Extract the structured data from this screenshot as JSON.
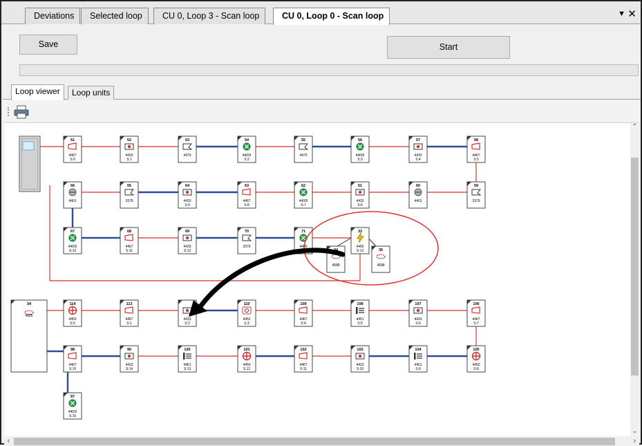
{
  "tabs": [
    {
      "label": "Deviations",
      "active": false
    },
    {
      "label": "Selected loop",
      "active": false
    },
    {
      "label": "CU 0, Loop 3 - Scan loop",
      "active": false
    },
    {
      "label": "CU 0, Loop 0 - Scan loop",
      "active": true
    }
  ],
  "tab_menu_icon": "chevron-down-icon",
  "tab_close_icon": "close-icon",
  "toolbar": {
    "save_label": "Save",
    "start_label": "Start"
  },
  "progress": {
    "value": 0
  },
  "inner_tabs": [
    {
      "label": "Loop viewer",
      "active": true
    },
    {
      "label": "Loop units",
      "active": false
    }
  ],
  "print_icon": "printer-icon",
  "colors": {
    "blue_line": "#2b4a9b",
    "red_line": "#e05050",
    "highlight": "#e03030"
  },
  "loop_units": [
    {
      "addr": "51",
      "type": "4467",
      "sub": "S:0",
      "icon": "sounder-icon"
    },
    {
      "addr": "52",
      "type": "4433",
      "sub": "S:1",
      "icon": "input-module-icon"
    },
    {
      "addr": "53",
      "type": "4479",
      "sub": "",
      "icon": "callpoint-icon"
    },
    {
      "addr": "54",
      "type": "4400I",
      "sub": "S:2",
      "icon": "smoke-detector-icon"
    },
    {
      "addr": "55",
      "type": "4479",
      "sub": "",
      "icon": "callpoint-icon"
    },
    {
      "addr": "56",
      "type": "4400I",
      "sub": "S:3",
      "icon": "smoke-detector-icon"
    },
    {
      "addr": "57",
      "type": "4433",
      "sub": "S:4",
      "icon": "input-module-icon"
    },
    {
      "addr": "58",
      "type": "4467",
      "sub": "S:5",
      "icon": "sounder-icon"
    },
    {
      "addr": "66",
      "type": "4401",
      "sub": "",
      "icon": "heat-detector-icon"
    },
    {
      "addr": "65",
      "type": "3379",
      "sub": "",
      "icon": "callpoint-icon"
    },
    {
      "addr": "64",
      "type": "4433",
      "sub": "S:9",
      "icon": "input-module-icon"
    },
    {
      "addr": "63",
      "type": "4467",
      "sub": "S:8",
      "icon": "sounder-icon"
    },
    {
      "addr": "62",
      "type": "4400I",
      "sub": "S:7",
      "icon": "smoke-detector-icon"
    },
    {
      "addr": "61",
      "type": "4433",
      "sub": "S:6",
      "icon": "input-module-icon"
    },
    {
      "addr": "60",
      "type": "4401",
      "sub": "",
      "icon": "heat-detector-icon"
    },
    {
      "addr": "59",
      "type": "3379",
      "sub": "",
      "icon": "callpoint-icon"
    },
    {
      "addr": "67",
      "type": "4400I",
      "sub": "S:10",
      "icon": "smoke-detector-icon"
    },
    {
      "addr": "68",
      "type": "4467",
      "sub": "S:11",
      "icon": "sounder-icon"
    },
    {
      "addr": "69",
      "type": "4433",
      "sub": "S:12",
      "icon": "input-module-icon"
    },
    {
      "addr": "70",
      "type": "3379",
      "sub": "",
      "icon": "callpoint-icon"
    },
    {
      "addr": "71",
      "type": "4400",
      "sub": "",
      "icon": "smoke-detector-icon"
    },
    {
      "addr": "33",
      "type": "4456",
      "sub": "S:13",
      "icon": "isolator-icon"
    },
    {
      "addr": "34",
      "type": "4588",
      "sub": "",
      "icon": "beacon-icon"
    },
    {
      "addr": "35",
      "type": "4588",
      "sub": "",
      "icon": "beacon-icon"
    },
    {
      "addr": "34",
      "type": "4585",
      "sub": "",
      "icon": "beacon-icon"
    },
    {
      "addr": "114",
      "type": "4450",
      "sub": "S:0",
      "icon": "crosshair-detector-icon"
    },
    {
      "addr": "113",
      "type": "4467",
      "sub": "S:1",
      "icon": "sounder-icon"
    },
    {
      "addr": "",
      "type": "4433",
      "sub": "S:2",
      "icon": "input-module-icon"
    },
    {
      "addr": "110",
      "type": "4452",
      "sub": "S:3",
      "icon": "alarm-device-icon"
    },
    {
      "addr": "109",
      "type": "4467",
      "sub": "S:4",
      "icon": "sounder-icon"
    },
    {
      "addr": "108",
      "type": "4451",
      "sub": "S:5",
      "icon": "io-unit-icon"
    },
    {
      "addr": "107",
      "type": "4433",
      "sub": "S:6",
      "icon": "input-module-icon"
    },
    {
      "addr": "106",
      "type": "4467",
      "sub": "S:7",
      "icon": "sounder-icon"
    },
    {
      "addr": "98",
      "type": "4467",
      "sub": "S:15",
      "icon": "sounder-icon"
    },
    {
      "addr": "99",
      "type": "4433",
      "sub": "S:14",
      "icon": "input-module-icon"
    },
    {
      "addr": "100",
      "type": "4451",
      "sub": "S:13",
      "icon": "io-unit-icon"
    },
    {
      "addr": "101",
      "type": "4450",
      "sub": "S:12",
      "icon": "crosshair-detector-icon"
    },
    {
      "addr": "102",
      "type": "4467",
      "sub": "S:11",
      "icon": "sounder-icon"
    },
    {
      "addr": "103",
      "type": "4433",
      "sub": "S:10",
      "icon": "input-module-icon"
    },
    {
      "addr": "104",
      "type": "4451",
      "sub": "S:9",
      "icon": "io-unit-icon"
    },
    {
      "addr": "105",
      "type": "4450",
      "sub": "S:8",
      "icon": "crosshair-detector-icon"
    },
    {
      "addr": "97",
      "type": "4400I",
      "sub": "S:16",
      "icon": "smoke-detector-icon"
    }
  ]
}
